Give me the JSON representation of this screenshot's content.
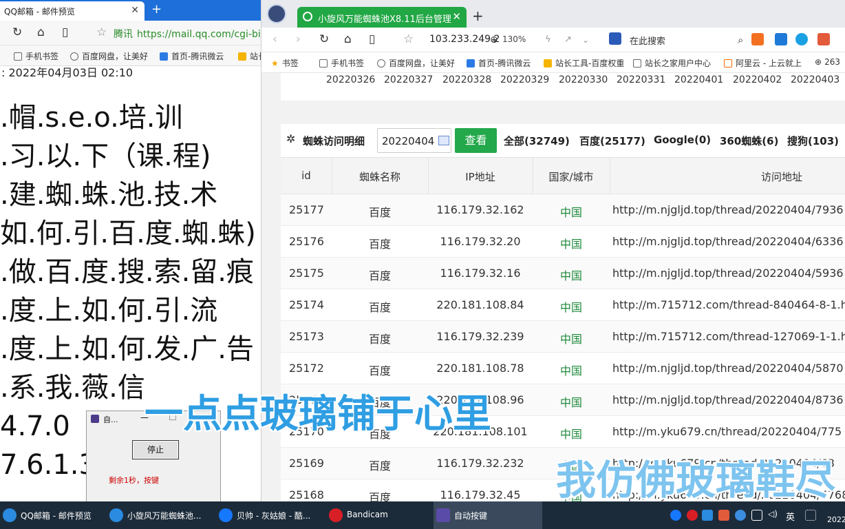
{
  "left_browser": {
    "tab_title": "QQ邮箱 - 邮件预览",
    "url_secure": "腾讯",
    "url": "https://mail.qq.com/cgi-bi",
    "bookmarks": [
      "手机书签",
      "百度网盘，让美好",
      "首页-腾讯微云",
      "站长"
    ],
    "date_line": ": 2022年04月03日 02:10",
    "content_lines": [
      ".帽.s.e.o.培.训",
      ".习.以.下（课.程)",
      ".建.蜘.蛛.池.技.术",
      "如.何.引.百.度.蜘.蛛)",
      ".做.百.度.搜.索.留.痕",
      ".度.上.如.何.引.流",
      ".度.上.如.何.发.广.告",
      ".系.我.薇.信",
      "4.7.0",
      "7.6.1.3"
    ]
  },
  "popup": {
    "title": "自...",
    "button": "停止",
    "message": "剩余1秒，按键"
  },
  "right_browser": {
    "tab_title": "小旋风万能蜘蛛池X8.11后台管理",
    "address": "103.233.249.2",
    "zoom": "130%",
    "search_placeholder": "在此搜索",
    "bookmarks": [
      "书签",
      "手机书签",
      "百度网盘，让美好",
      "首页-腾讯微云",
      "站长工具-百度权重",
      "站长之家用户中心",
      "阿里云 - 上云就上",
      "263"
    ]
  },
  "dates": [
    "20220326",
    "20220327",
    "20220328",
    "20220329",
    "20220330",
    "20220331",
    "20220401",
    "20220402",
    "20220403"
  ],
  "panel": {
    "title": "蜘蛛访问明细",
    "date_value": "20220404",
    "query_button": "查看",
    "stats": [
      "全部(32749)",
      "百度(25177)",
      "Google(0)",
      "360蜘蛛(6)",
      "搜狗(103)"
    ]
  },
  "table": {
    "headers": [
      "id",
      "蜘蛛名称",
      "IP地址",
      "国家/城市",
      "访问地址"
    ],
    "rows": [
      {
        "id": "25177",
        "name": "百度",
        "ip": "116.179.32.162",
        "country": "中国",
        "url": "http://m.njgljd.top/thread/20220404/7936"
      },
      {
        "id": "25176",
        "name": "百度",
        "ip": "116.179.32.20",
        "country": "中国",
        "url": "http://m.njgljd.top/thread/20220404/6336"
      },
      {
        "id": "25175",
        "name": "百度",
        "ip": "116.179.32.16",
        "country": "中国",
        "url": "http://m.njgljd.top/thread/20220404/5936"
      },
      {
        "id": "25174",
        "name": "百度",
        "ip": "220.181.108.84",
        "country": "中国",
        "url": "http://m.715712.com/thread-840464-8-1.h"
      },
      {
        "id": "25173",
        "name": "百度",
        "ip": "116.179.32.239",
        "country": "中国",
        "url": "http://m.715712.com/thread-127069-1-1.h"
      },
      {
        "id": "25172",
        "name": "百度",
        "ip": "220.181.108.78",
        "country": "中国",
        "url": "http://m.njgljd.top/thread/20220404/5870"
      },
      {
        "id": "25171",
        "name": "百度",
        "ip": "220.181.108.96",
        "country": "中国",
        "url": "http://m.njgljd.top/thread/20220404/8736"
      },
      {
        "id": "25170",
        "name": "百度",
        "ip": "220.181.108.101",
        "country": "中国",
        "url": "http://m.yku679.cn/thread/20220404/775"
      },
      {
        "id": "25169",
        "name": "百度",
        "ip": "116.179.32.232",
        "country": "中国",
        "url": "http://m.yku679.cn/thread/20220404/63"
      },
      {
        "id": "25168",
        "name": "百度",
        "ip": "116.179.32.45",
        "country": "中国",
        "url": "http://m.yku679.cn/thread/20220404/4768"
      }
    ]
  },
  "subtitles": {
    "line1": "一点点玻璃铺于心里",
    "line2": "我仿佛玻璃鞋尽"
  },
  "taskbar": {
    "items": [
      "QQ邮箱 - 邮件预览",
      "小旋风万能蜘蛛池...",
      "贝帅 - 灰姑娘 - 酷...",
      "Bandicam",
      "自动按键"
    ],
    "lang": "英",
    "year": "2022"
  },
  "colors": {
    "accent_green": "#23a84b",
    "country_green": "#1f8a3c",
    "left_tabbar_blue": "#1e6fd9",
    "subtitle_blue": "#2f9ee3"
  }
}
